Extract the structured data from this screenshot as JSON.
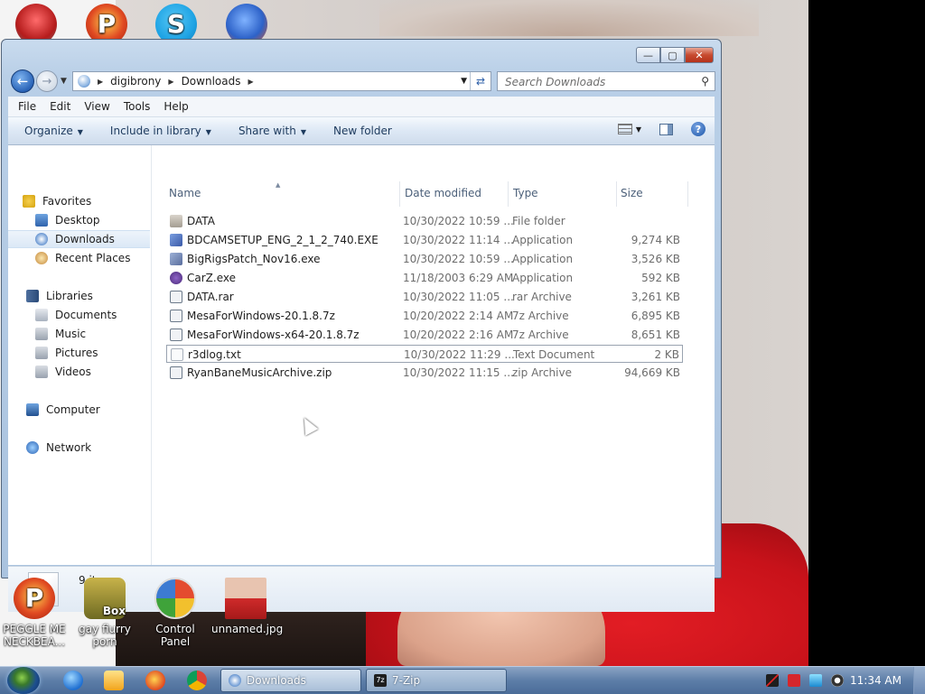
{
  "desktop": {
    "top_icons": [
      {
        "icon": "red-button-app-icon",
        "color": "#d22c2c"
      },
      {
        "icon": "peggle-p-icon",
        "color": "#e04a22"
      },
      {
        "icon": "skype-icon",
        "color": "#1ea3e4"
      },
      {
        "icon": "globe-app-icon",
        "color": "#2d62c8"
      }
    ],
    "bottom_icons": [
      {
        "label": "PEGGLE ME NECKBEA...",
        "icon": "peggle-p-icon",
        "color": "#e04a22"
      },
      {
        "label": "gay fiurry porn",
        "icon": "box-cartoon-icon",
        "color": "#8c8a2a",
        "badge": "Box"
      },
      {
        "label": "Control Panel",
        "icon": "control-panel-icon",
        "color": "#3d7bd2"
      },
      {
        "label": "unnamed.jpg",
        "icon": "image-thumbnail-icon",
        "color": "#cf2a2a"
      }
    ]
  },
  "window": {
    "buttons": {
      "minimize": "—",
      "maximize": "▢",
      "close": "✕"
    },
    "address": {
      "crumbs": [
        "digibrony",
        "Downloads"
      ]
    },
    "search": {
      "placeholder": "Search Downloads"
    },
    "menu": [
      "File",
      "Edit",
      "View",
      "Tools",
      "Help"
    ],
    "commands": [
      {
        "label": "Organize",
        "dropdown": true
      },
      {
        "label": "Include in library",
        "dropdown": true
      },
      {
        "label": "Share with",
        "dropdown": true
      },
      {
        "label": "New folder",
        "dropdown": false
      }
    ],
    "nav": {
      "favorites": "Favorites",
      "desktop": "Desktop",
      "downloads": "Downloads",
      "recent": "Recent Places",
      "libraries": "Libraries",
      "documents": "Documents",
      "music": "Music",
      "pictures": "Pictures",
      "videos": "Videos",
      "computer": "Computer",
      "network": "Network"
    },
    "columns": {
      "name": "Name",
      "date": "Date modified",
      "type": "Type",
      "size": "Size"
    },
    "files": [
      {
        "name": "DATA",
        "date": "10/30/2022 10:59 ...",
        "type": "File folder",
        "size": "",
        "icon": "folder-icon",
        "color": "#b9b3aa"
      },
      {
        "name": "BDCAMSETUP_ENG_2_1_2_740.EXE",
        "date": "10/30/2022 11:14 ...",
        "type": "Application",
        "size": "9,274 KB",
        "icon": "installer-icon",
        "color": "#3b5aa8"
      },
      {
        "name": "BigRigsPatch_Nov16.exe",
        "date": "10/30/2022 10:59 ...",
        "type": "Application",
        "size": "3,526 KB",
        "icon": "patch-exe-icon",
        "color": "#5a6e9e"
      },
      {
        "name": "CarZ.exe",
        "date": "11/18/2003 6:29 AM",
        "type": "Application",
        "size": "592 KB",
        "icon": "car-exe-icon",
        "color": "#4b2a7a"
      },
      {
        "name": "DATA.rar",
        "date": "10/30/2022 11:05 ...",
        "type": "rar Archive",
        "size": "3,261 KB",
        "icon": "archive-icon",
        "color": "#6c7a8a"
      },
      {
        "name": "MesaForWindows-20.1.8.7z",
        "date": "10/20/2022 2:14 AM",
        "type": "7z Archive",
        "size": "6,895 KB",
        "icon": "archive-icon",
        "color": "#6c7a8a"
      },
      {
        "name": "MesaForWindows-x64-20.1.8.7z",
        "date": "10/20/2022 2:16 AM",
        "type": "7z Archive",
        "size": "8,651 KB",
        "icon": "archive-icon",
        "color": "#6c7a8a"
      },
      {
        "name": "r3dlog.txt",
        "date": "10/30/2022 11:29 ...",
        "type": "Text Document",
        "size": "2 KB",
        "icon": "text-file-icon",
        "color": "#d8dde4"
      },
      {
        "name": "RyanBaneMusicArchive.zip",
        "date": "10/30/2022 11:15 ...",
        "type": "zip Archive",
        "size": "94,669 KB",
        "icon": "archive-icon",
        "color": "#6c7a8a"
      }
    ],
    "status": {
      "item_count": "9 items"
    }
  },
  "taskbar": {
    "tasks": [
      {
        "label": "Downloads",
        "icon": "explorer-icon",
        "active": true
      },
      {
        "label": "7-Zip",
        "icon": "7zip-icon",
        "active": false
      }
    ],
    "clock": "11:34 AM"
  },
  "colors": {
    "accent": "#3d73b9",
    "selection": "#dbe8f6"
  }
}
